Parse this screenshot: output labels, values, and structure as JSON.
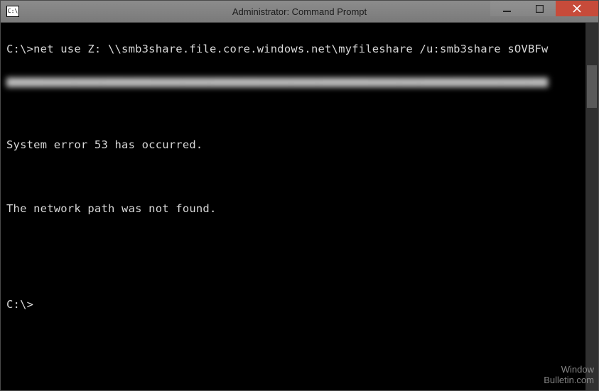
{
  "window": {
    "title": "Administrator: Command Prompt",
    "icon_glyph": "C:\\"
  },
  "terminal": {
    "prompt1": "C:\\>",
    "command": "net use Z: \\\\smb3share.file.core.windows.net\\myfileshare /u:smb3share sOVBFw",
    "obscured_line": "▆▆▆▆▆▆▆▆▆▆▆▆▆▆▆▆▆▆▆▆▆▆▆▆▆▆▆▆▆▆▆▆▆▆▆▆▆▆▆▆▆▆▆▆▆▆▆▆▆▆▆▆▆▆▆▆▆▆▆▆▆▆▆▆▆▆▆▆▆▆▆▆▆▆▆▆▆▆▆▆",
    "error1": "System error 53 has occurred.",
    "error2": "The network path was not found.",
    "prompt2": "C:\\>"
  },
  "watermark": {
    "line1": "Window",
    "line2": "Bulletin.com"
  }
}
